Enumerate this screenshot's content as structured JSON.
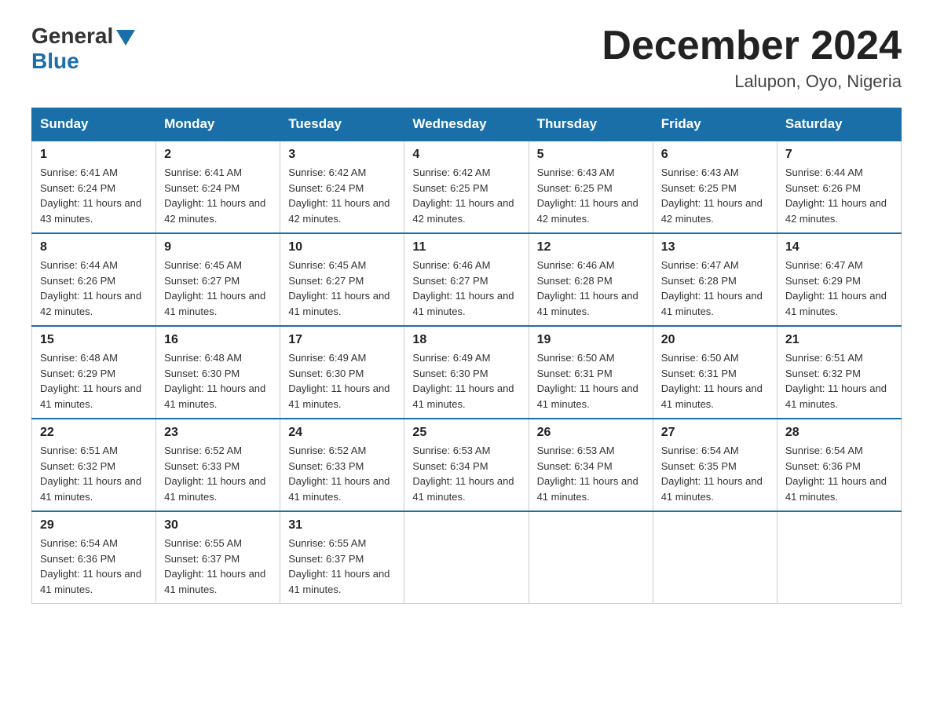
{
  "header": {
    "logo_general": "General",
    "logo_blue": "Blue",
    "month_title": "December 2024",
    "location": "Lalupon, Oyo, Nigeria"
  },
  "days_of_week": [
    "Sunday",
    "Monday",
    "Tuesday",
    "Wednesday",
    "Thursday",
    "Friday",
    "Saturday"
  ],
  "weeks": [
    [
      {
        "day": "1",
        "sunrise": "6:41 AM",
        "sunset": "6:24 PM",
        "daylight": "11 hours and 43 minutes."
      },
      {
        "day": "2",
        "sunrise": "6:41 AM",
        "sunset": "6:24 PM",
        "daylight": "11 hours and 42 minutes."
      },
      {
        "day": "3",
        "sunrise": "6:42 AM",
        "sunset": "6:24 PM",
        "daylight": "11 hours and 42 minutes."
      },
      {
        "day": "4",
        "sunrise": "6:42 AM",
        "sunset": "6:25 PM",
        "daylight": "11 hours and 42 minutes."
      },
      {
        "day": "5",
        "sunrise": "6:43 AM",
        "sunset": "6:25 PM",
        "daylight": "11 hours and 42 minutes."
      },
      {
        "day": "6",
        "sunrise": "6:43 AM",
        "sunset": "6:25 PM",
        "daylight": "11 hours and 42 minutes."
      },
      {
        "day": "7",
        "sunrise": "6:44 AM",
        "sunset": "6:26 PM",
        "daylight": "11 hours and 42 minutes."
      }
    ],
    [
      {
        "day": "8",
        "sunrise": "6:44 AM",
        "sunset": "6:26 PM",
        "daylight": "11 hours and 42 minutes."
      },
      {
        "day": "9",
        "sunrise": "6:45 AM",
        "sunset": "6:27 PM",
        "daylight": "11 hours and 41 minutes."
      },
      {
        "day": "10",
        "sunrise": "6:45 AM",
        "sunset": "6:27 PM",
        "daylight": "11 hours and 41 minutes."
      },
      {
        "day": "11",
        "sunrise": "6:46 AM",
        "sunset": "6:27 PM",
        "daylight": "11 hours and 41 minutes."
      },
      {
        "day": "12",
        "sunrise": "6:46 AM",
        "sunset": "6:28 PM",
        "daylight": "11 hours and 41 minutes."
      },
      {
        "day": "13",
        "sunrise": "6:47 AM",
        "sunset": "6:28 PM",
        "daylight": "11 hours and 41 minutes."
      },
      {
        "day": "14",
        "sunrise": "6:47 AM",
        "sunset": "6:29 PM",
        "daylight": "11 hours and 41 minutes."
      }
    ],
    [
      {
        "day": "15",
        "sunrise": "6:48 AM",
        "sunset": "6:29 PM",
        "daylight": "11 hours and 41 minutes."
      },
      {
        "day": "16",
        "sunrise": "6:48 AM",
        "sunset": "6:30 PM",
        "daylight": "11 hours and 41 minutes."
      },
      {
        "day": "17",
        "sunrise": "6:49 AM",
        "sunset": "6:30 PM",
        "daylight": "11 hours and 41 minutes."
      },
      {
        "day": "18",
        "sunrise": "6:49 AM",
        "sunset": "6:30 PM",
        "daylight": "11 hours and 41 minutes."
      },
      {
        "day": "19",
        "sunrise": "6:50 AM",
        "sunset": "6:31 PM",
        "daylight": "11 hours and 41 minutes."
      },
      {
        "day": "20",
        "sunrise": "6:50 AM",
        "sunset": "6:31 PM",
        "daylight": "11 hours and 41 minutes."
      },
      {
        "day": "21",
        "sunrise": "6:51 AM",
        "sunset": "6:32 PM",
        "daylight": "11 hours and 41 minutes."
      }
    ],
    [
      {
        "day": "22",
        "sunrise": "6:51 AM",
        "sunset": "6:32 PM",
        "daylight": "11 hours and 41 minutes."
      },
      {
        "day": "23",
        "sunrise": "6:52 AM",
        "sunset": "6:33 PM",
        "daylight": "11 hours and 41 minutes."
      },
      {
        "day": "24",
        "sunrise": "6:52 AM",
        "sunset": "6:33 PM",
        "daylight": "11 hours and 41 minutes."
      },
      {
        "day": "25",
        "sunrise": "6:53 AM",
        "sunset": "6:34 PM",
        "daylight": "11 hours and 41 minutes."
      },
      {
        "day": "26",
        "sunrise": "6:53 AM",
        "sunset": "6:34 PM",
        "daylight": "11 hours and 41 minutes."
      },
      {
        "day": "27",
        "sunrise": "6:54 AM",
        "sunset": "6:35 PM",
        "daylight": "11 hours and 41 minutes."
      },
      {
        "day": "28",
        "sunrise": "6:54 AM",
        "sunset": "6:36 PM",
        "daylight": "11 hours and 41 minutes."
      }
    ],
    [
      {
        "day": "29",
        "sunrise": "6:54 AM",
        "sunset": "6:36 PM",
        "daylight": "11 hours and 41 minutes."
      },
      {
        "day": "30",
        "sunrise": "6:55 AM",
        "sunset": "6:37 PM",
        "daylight": "11 hours and 41 minutes."
      },
      {
        "day": "31",
        "sunrise": "6:55 AM",
        "sunset": "6:37 PM",
        "daylight": "11 hours and 41 minutes."
      },
      null,
      null,
      null,
      null
    ]
  ]
}
